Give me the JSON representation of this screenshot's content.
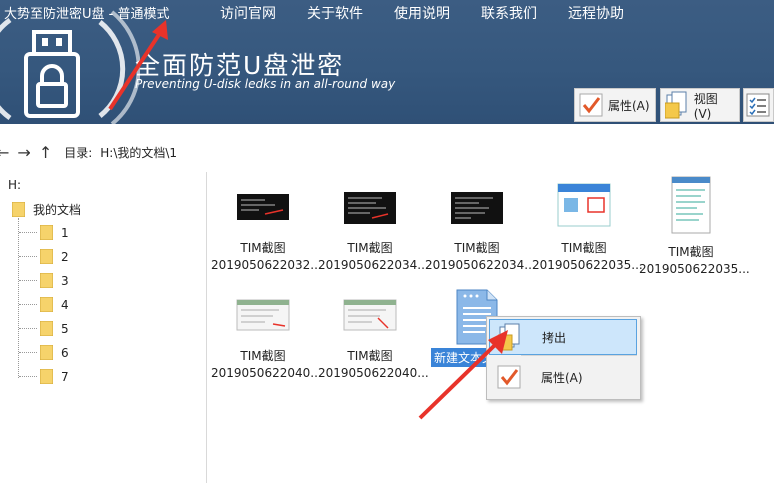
{
  "header": {
    "app_title": "大势至防泄密U盘 - 普通模式",
    "menu": [
      "访问官网",
      "关于软件",
      "使用说明",
      "联系我们",
      "远程协助"
    ],
    "slogan_cn": "全面防范U盘泄密",
    "slogan_en": "Preventing U-disk ledks in an all-round way",
    "toolbar": {
      "properties_label": "属性(A)",
      "view_label": "视图(V)"
    }
  },
  "address": {
    "label": "目录:",
    "path": "H:\\我的文档\\1"
  },
  "tree": {
    "root": "H:",
    "folder": "我的文档",
    "children": [
      "1",
      "2",
      "3",
      "4",
      "5",
      "6",
      "7"
    ]
  },
  "files": [
    {
      "name1": "TIM截图",
      "name2": "2019050622032..."
    },
    {
      "name1": "TIM截图",
      "name2": "2019050622034..."
    },
    {
      "name1": "TIM截图",
      "name2": "2019050622034..."
    },
    {
      "name1": "TIM截图",
      "name2": "2019050622035..."
    },
    {
      "name1": "TIM截图",
      "name2": "2019050622035..."
    },
    {
      "name1": "TIM截图",
      "name2": "2019050622040..."
    },
    {
      "name1": "TIM截图",
      "name2": "2019050622040..."
    }
  ],
  "selected_file": {
    "name": "新建文本文"
  },
  "context_menu": {
    "items": [
      "拷出",
      "属性(A)"
    ]
  },
  "colors": {
    "header_bg": "#36587e",
    "selection": "#3a84d8",
    "menu_highlight": "#cde6fb",
    "annotation_arrow": "#e8332a"
  }
}
